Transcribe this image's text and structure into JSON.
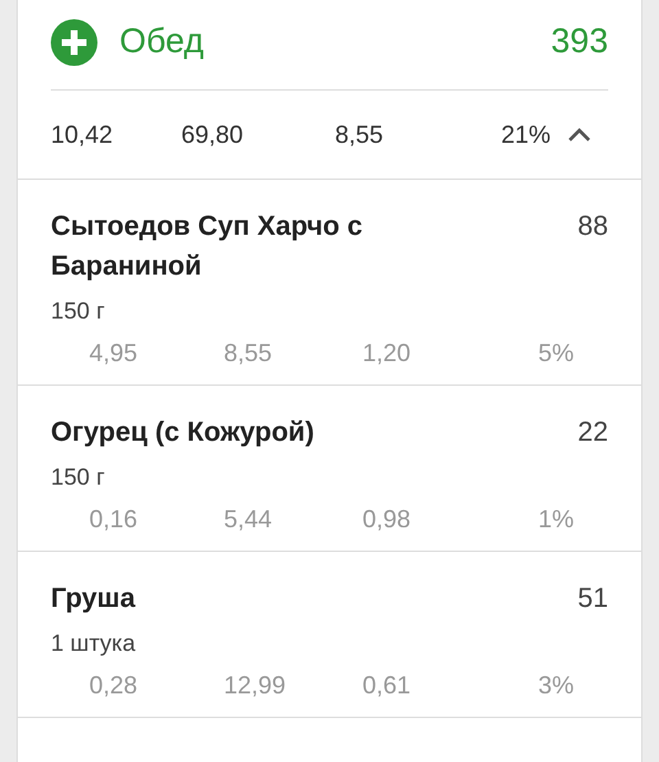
{
  "meal": {
    "name": "Обед",
    "calories": "393",
    "expanded": true
  },
  "summary": [
    "10,42",
    "69,80",
    "8,55",
    "21%"
  ],
  "items": [
    {
      "name": "Сытоедов Суп Харчо с Бараниной",
      "calories": "88",
      "portion": "150 г",
      "values": [
        "4,95",
        "8,55",
        "1,20",
        "5%"
      ]
    },
    {
      "name": "Огурец (с Кожурой)",
      "calories": "22",
      "portion": "150 г",
      "values": [
        "0,16",
        "5,44",
        "0,98",
        "1%"
      ]
    },
    {
      "name": "Груша",
      "calories": "51",
      "portion": "1 штука",
      "values": [
        "0,28",
        "12,99",
        "0,61",
        "3%"
      ]
    }
  ]
}
